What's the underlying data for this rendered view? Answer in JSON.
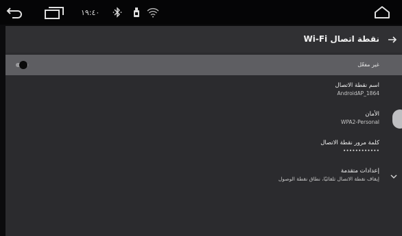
{
  "status_bar": {
    "time": "١٩:٤٠",
    "icons": [
      "back-icon",
      "recent-apps-icon",
      "bluetooth-icon",
      "usb-icon",
      "wifi-icon",
      "home-icon"
    ]
  },
  "header": {
    "title": "نقطة اتصال Wi-Fi",
    "back_icon": "arrow-right-icon"
  },
  "toggle": {
    "label": "غير مفعّل",
    "state": "off"
  },
  "preferences": [
    {
      "title": "اسم نقطة الاتصال",
      "summary": "AndroidAP_1864"
    },
    {
      "title": "الأمان",
      "summary": "WPA2-Personal"
    },
    {
      "title": "كلمة مرور نقطة الاتصال",
      "summary": "••••••••••••"
    },
    {
      "title": "إعدادات متقدمة",
      "summary": "إيقاف نقطة الاتصال تلقائيًا، نطاق نقطة الوصول"
    }
  ],
  "colors": {
    "status_bar_bg": "#050506",
    "app_bg": "#2b2b2e",
    "toggle_row_bg": "#5e5e62"
  }
}
